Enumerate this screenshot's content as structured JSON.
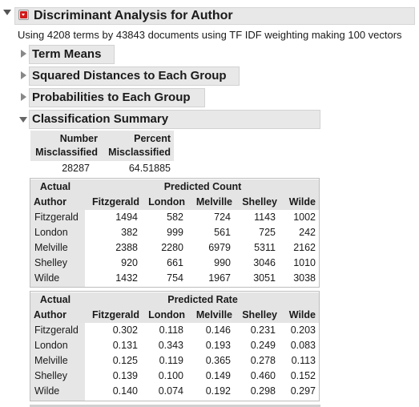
{
  "report": {
    "title": "Discriminant Analysis for Author",
    "subtitle": "Using 4208 terms by 43843 documents using TF IDF weighting making 100 vectors"
  },
  "sections": {
    "term_means": "Term Means",
    "squared_distances": "Squared Distances to Each Group",
    "probabilities": "Probabilities to Each Group",
    "classification_summary": "Classification Summary"
  },
  "misclassified": {
    "number_header_1": "Number",
    "number_header_2": "Misclassified",
    "percent_header_1": "Percent",
    "percent_header_2": "Misclassified",
    "number_value": "28287",
    "percent_value": "64.51885"
  },
  "count_table": {
    "actual_label": "Actual",
    "author_label": "Author",
    "predicted_label": "Predicted Count",
    "columns": [
      "Fitzgerald",
      "London",
      "Melville",
      "Shelley",
      "Wilde"
    ],
    "rows": [
      {
        "author": "Fitzgerald",
        "values": [
          "1494",
          "582",
          "724",
          "1143",
          "1002"
        ]
      },
      {
        "author": "London",
        "values": [
          "382",
          "999",
          "561",
          "725",
          "242"
        ]
      },
      {
        "author": "Melville",
        "values": [
          "2388",
          "2280",
          "6979",
          "5311",
          "2162"
        ]
      },
      {
        "author": "Shelley",
        "values": [
          "920",
          "661",
          "990",
          "3046",
          "1010"
        ]
      },
      {
        "author": "Wilde",
        "values": [
          "1432",
          "754",
          "1967",
          "3051",
          "3038"
        ]
      }
    ]
  },
  "rate_table": {
    "actual_label": "Actual",
    "author_label": "Author",
    "predicted_label": "Predicted Rate",
    "columns": [
      "Fitzgerald",
      "London",
      "Melville",
      "Shelley",
      "Wilde"
    ],
    "rows": [
      {
        "author": "Fitzgerald",
        "values": [
          "0.302",
          "0.118",
          "0.146",
          "0.231",
          "0.203"
        ]
      },
      {
        "author": "London",
        "values": [
          "0.131",
          "0.343",
          "0.193",
          "0.249",
          "0.083"
        ]
      },
      {
        "author": "Melville",
        "values": [
          "0.125",
          "0.119",
          "0.365",
          "0.278",
          "0.113"
        ]
      },
      {
        "author": "Shelley",
        "values": [
          "0.139",
          "0.100",
          "0.149",
          "0.460",
          "0.152"
        ]
      },
      {
        "author": "Wilde",
        "values": [
          "0.140",
          "0.074",
          "0.192",
          "0.298",
          "0.297"
        ]
      }
    ]
  },
  "colors": {
    "red_menu": "#d11a1a",
    "header_bg": "#e8e8e8"
  }
}
